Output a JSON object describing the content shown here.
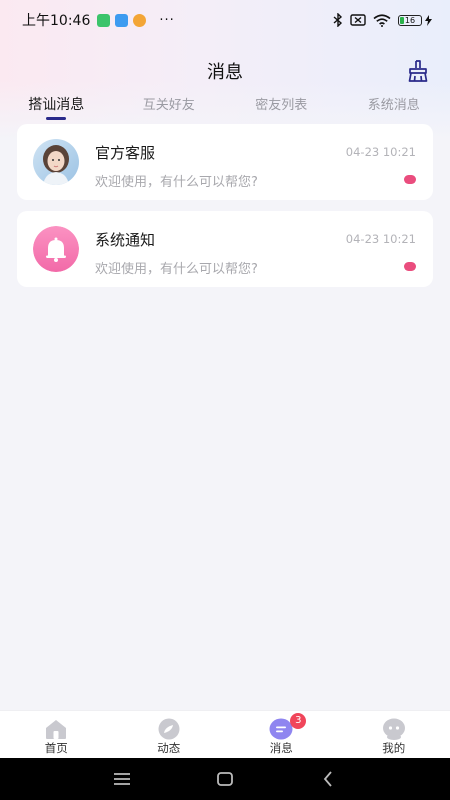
{
  "status_bar": {
    "time": "上午10:46",
    "more": "···",
    "battery": "16"
  },
  "header": {
    "title": "消息"
  },
  "tabs": [
    {
      "label": "搭讪消息",
      "active": true
    },
    {
      "label": "互关好友",
      "active": false
    },
    {
      "label": "密友列表",
      "active": false
    },
    {
      "label": "系统消息",
      "active": false
    }
  ],
  "conversations": [
    {
      "name": "官方客服",
      "time": "04-23 10:21",
      "preview": "欢迎使用，有什么可以帮您?",
      "avatar": "photo-avatar",
      "unread": true
    },
    {
      "name": "系统通知",
      "time": "04-23 10:21",
      "preview": "欢迎使用，有什么可以帮您?",
      "avatar": "bell-icon",
      "unread": true
    }
  ],
  "bottom_nav": [
    {
      "label": "首页",
      "icon": "home-icon"
    },
    {
      "label": "动态",
      "icon": "compass-icon"
    },
    {
      "label": "消息",
      "icon": "message-icon",
      "badge": "3",
      "active": true
    },
    {
      "label": "我的",
      "icon": "profile-icon"
    }
  ],
  "colors": {
    "accent": "#2a2a8a",
    "unread_dot": "#ea4d7e",
    "badge": "#f0455a",
    "message_icon_active": "#8f85f0",
    "bell_bg": "#f77fb4"
  }
}
